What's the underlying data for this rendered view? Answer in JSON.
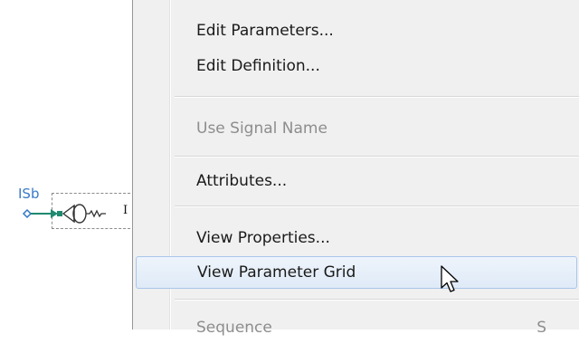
{
  "schematic": {
    "signal_label": "ISb",
    "instance_label": "I",
    "symbol_icon": "current-source-symbol-icon"
  },
  "context_menu": {
    "items": [
      {
        "label": "Edit Parameters...",
        "enabled": true
      },
      {
        "label": "Edit Definition...",
        "enabled": true
      },
      {
        "label": "Use Signal Name",
        "enabled": false
      },
      {
        "label": "Attributes...",
        "enabled": true
      },
      {
        "label": "View Properties...",
        "enabled": true
      },
      {
        "label": "View Parameter Grid",
        "enabled": true,
        "highlighted": true
      },
      {
        "label": "Sequence",
        "enabled": false,
        "shortcut": "S"
      }
    ]
  },
  "colors": {
    "menu_background": "#f0f0f0",
    "highlight_border": "#a9c6ea",
    "signal_label": "#3a7ac8",
    "wire": "#1f8a70"
  },
  "cursor_icon": "arrow-pointer-icon"
}
